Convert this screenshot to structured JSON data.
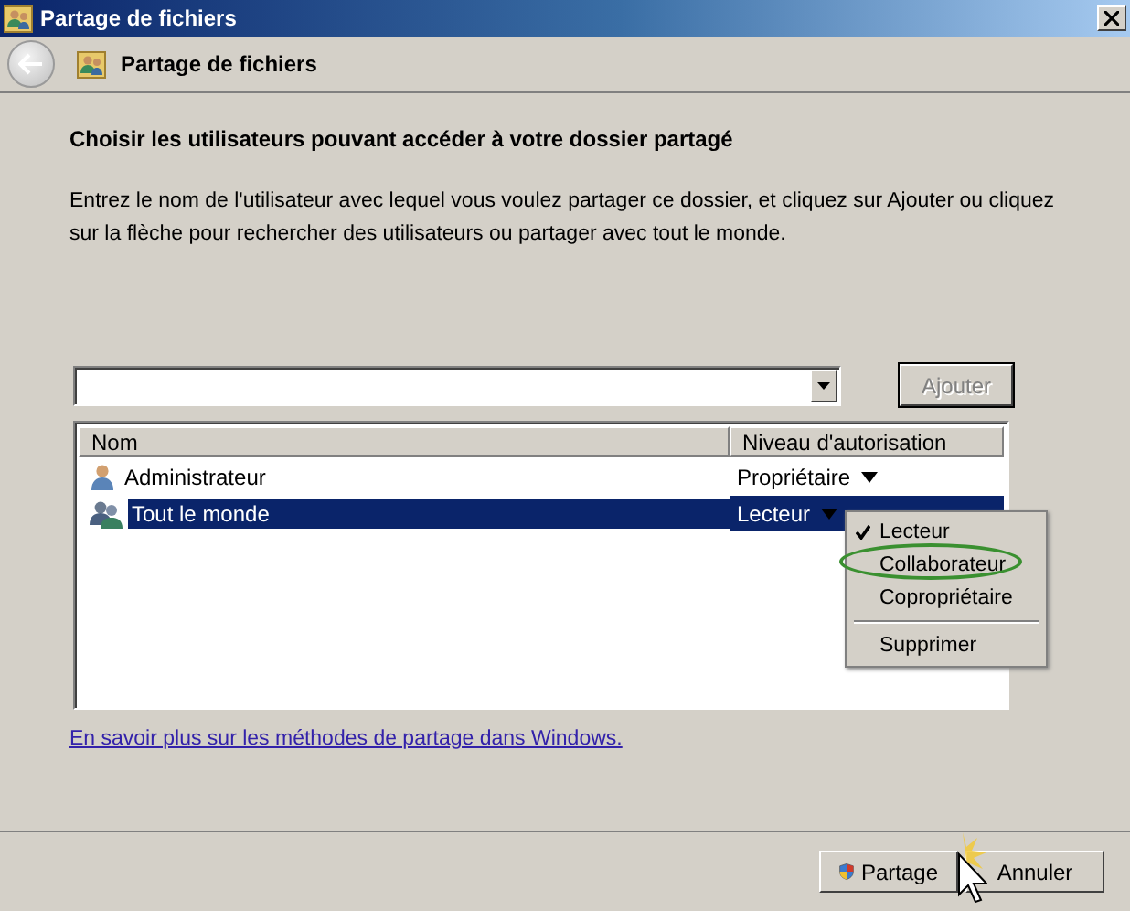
{
  "window": {
    "title": "Partage de fichiers"
  },
  "header": {
    "title": "Partage de fichiers"
  },
  "heading": "Choisir les utilisateurs pouvant accéder à votre dossier partagé",
  "instructions": "Entrez le nom de l'utilisateur avec lequel vous voulez partager ce dossier, et cliquez sur Ajouter ou cliquez sur la flèche pour rechercher des utilisateurs ou partager avec tout le monde.",
  "user_field": {
    "add_button": {
      "label": "Ajouter",
      "disabled": true
    }
  },
  "table": {
    "columns": [
      "Nom",
      "Niveau d'autorisation"
    ],
    "rows": [
      {
        "kind": "user",
        "name": "Administrateur",
        "level": "Propriétaire",
        "selected": false
      },
      {
        "kind": "group",
        "name": "Tout le monde",
        "level": "Lecteur",
        "selected": true
      }
    ]
  },
  "menu": {
    "items": [
      {
        "kind": "option",
        "label": "Lecteur",
        "checked": true,
        "circled": false
      },
      {
        "kind": "option",
        "label": "Collaborateur",
        "checked": false,
        "circled": true
      },
      {
        "kind": "option",
        "label": "Copropriétaire",
        "checked": false,
        "circled": false
      },
      {
        "kind": "action",
        "label": "Supprimer",
        "checked": false,
        "circled": false
      }
    ]
  },
  "link": "En savoir plus sur les méthodes de partage dans Windows.",
  "buttons": [
    {
      "kind": "shield",
      "label": "Partage"
    },
    {
      "kind": "plain",
      "label": "Annuler"
    }
  ]
}
